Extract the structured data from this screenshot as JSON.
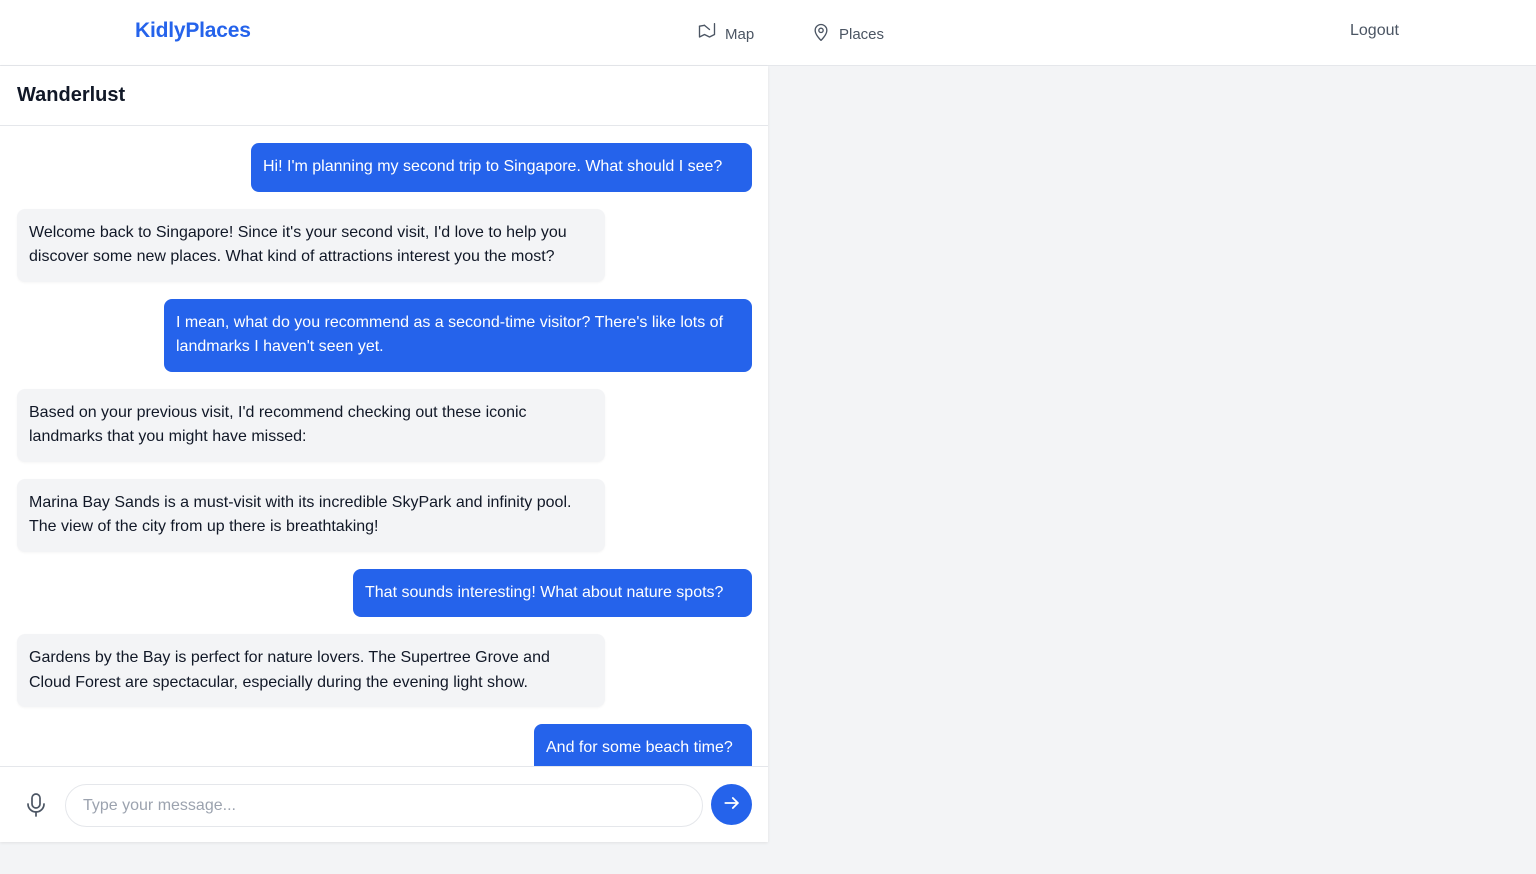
{
  "header": {
    "brand": "KidlyPlaces",
    "nav": [
      {
        "label": "Map",
        "icon": "map-icon"
      },
      {
        "label": "Places",
        "icon": "location-pin-icon"
      }
    ],
    "logout_label": "Logout"
  },
  "chat": {
    "title": "Wanderlust",
    "messages": [
      {
        "role": "user",
        "text": "Hi! I'm planning my second trip to Singapore. What should I see?"
      },
      {
        "role": "assistant",
        "text": "Welcome back to Singapore! Since it's your second visit, I'd love to help you discover some new places. What kind of attractions interest you the most?"
      },
      {
        "role": "user",
        "text": "I mean, what do you recommend as a second-time visitor? There's like lots of landmarks I haven't seen yet."
      },
      {
        "role": "assistant",
        "text": "Based on your previous visit, I'd recommend checking out these iconic landmarks that you might have missed:"
      },
      {
        "role": "assistant",
        "text": "Marina Bay Sands is a must-visit with its incredible SkyPark and infinity pool. The view of the city from up there is breathtaking!"
      },
      {
        "role": "user",
        "text": "That sounds interesting! What about nature spots?"
      },
      {
        "role": "assistant",
        "text": "Gardens by the Bay is perfect for nature lovers. The Supertree Grove and Cloud Forest are spectacular, especially during the evening light show."
      },
      {
        "role": "user",
        "text": "And for some beach time?"
      }
    ],
    "input": {
      "value": "",
      "placeholder": "Type your message..."
    },
    "icons": {
      "mic": "microphone-icon",
      "send": "arrow-right-icon"
    }
  },
  "colors": {
    "accent": "#2563eb",
    "page_background": "#f3f4f6",
    "assistant_bubble": "#f3f4f6",
    "user_bubble": "#2563eb"
  }
}
